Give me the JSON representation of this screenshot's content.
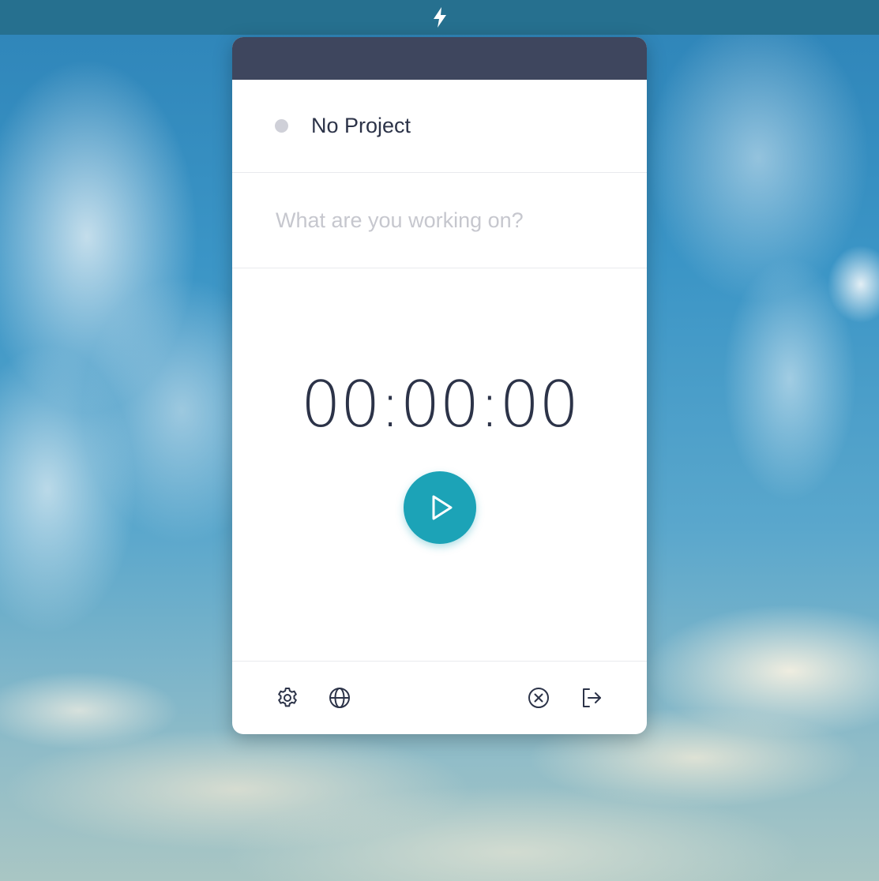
{
  "menubar": {
    "icon": "lightning-bolt-icon"
  },
  "popover": {
    "project": {
      "name": "No Project",
      "dot_color": "#cfd0d8"
    },
    "task": {
      "value": "",
      "placeholder": "What are you working on?"
    },
    "timer": {
      "display": "00:00:00",
      "play_icon": "play-icon",
      "accent_color": "#1ca3b7"
    },
    "footer": {
      "left_icons": [
        "gear-icon",
        "globe-icon"
      ],
      "right_icons": [
        "close-circle-icon",
        "logout-icon"
      ]
    }
  },
  "colors": {
    "titlebar": "#3e465e",
    "menubar": "#26708f",
    "text": "#2c3348",
    "placeholder": "#c6c7ce"
  }
}
